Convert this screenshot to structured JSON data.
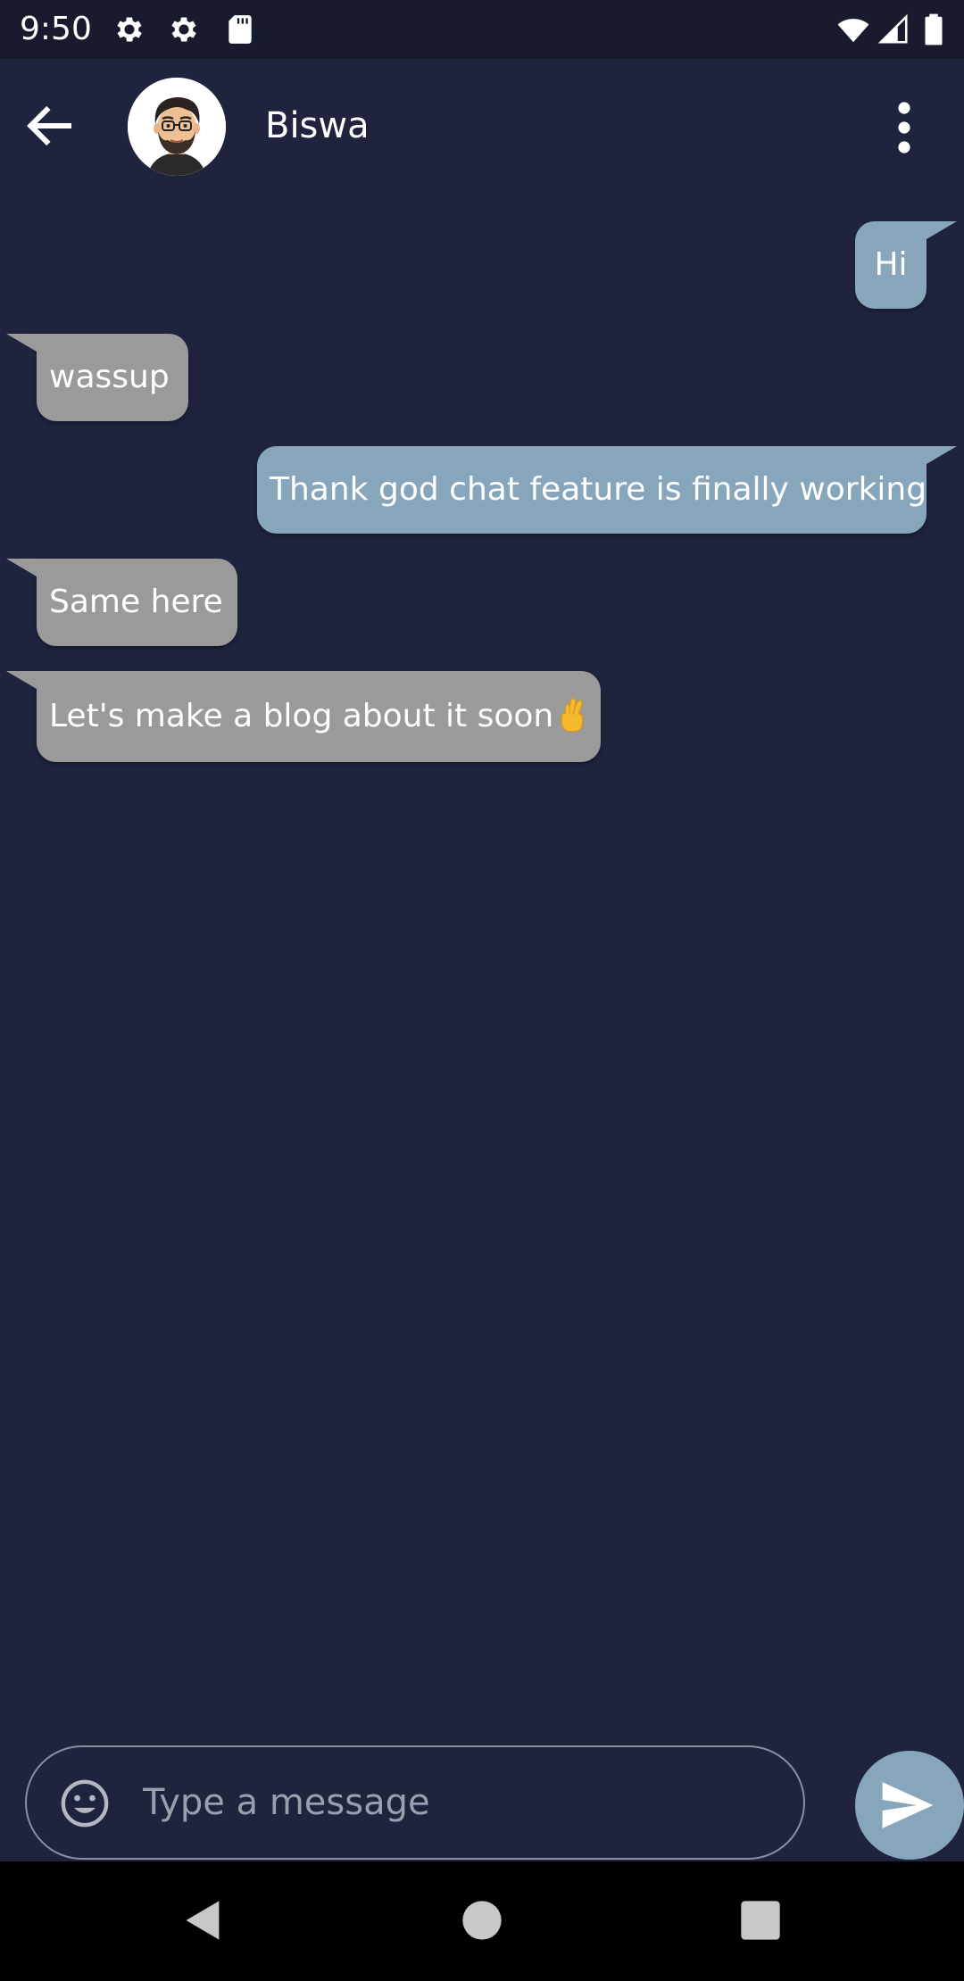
{
  "status_bar": {
    "time": "9:50",
    "left_icons": [
      "gear-icon",
      "gear-icon",
      "sd-card-icon"
    ],
    "right_icons": [
      "wifi-icon",
      "cell-signal-icon",
      "battery-icon"
    ]
  },
  "header": {
    "contact_name": "Biswa",
    "back_icon": "arrow-left-icon",
    "menu_icon": "more-vert-icon"
  },
  "messages": [
    {
      "direction": "outgoing",
      "text": "Hi"
    },
    {
      "direction": "incoming",
      "text": "wassup"
    },
    {
      "direction": "outgoing",
      "text": "Thank god chat feature is finally working"
    },
    {
      "direction": "incoming",
      "text": "Same here"
    },
    {
      "direction": "incoming",
      "text": "Let's make a blog about it soon",
      "emoji": "crossed-fingers"
    }
  ],
  "composer": {
    "placeholder": "Type a message",
    "value": "",
    "emoji_icon": "smiley-icon",
    "send_icon": "send-icon"
  },
  "colors": {
    "background": "#1f233d",
    "status_bar": "#181b2e",
    "outgoing_bubble": "#87a5bb",
    "incoming_bubble": "#9a9a9a",
    "send_button": "#87a5bb"
  }
}
